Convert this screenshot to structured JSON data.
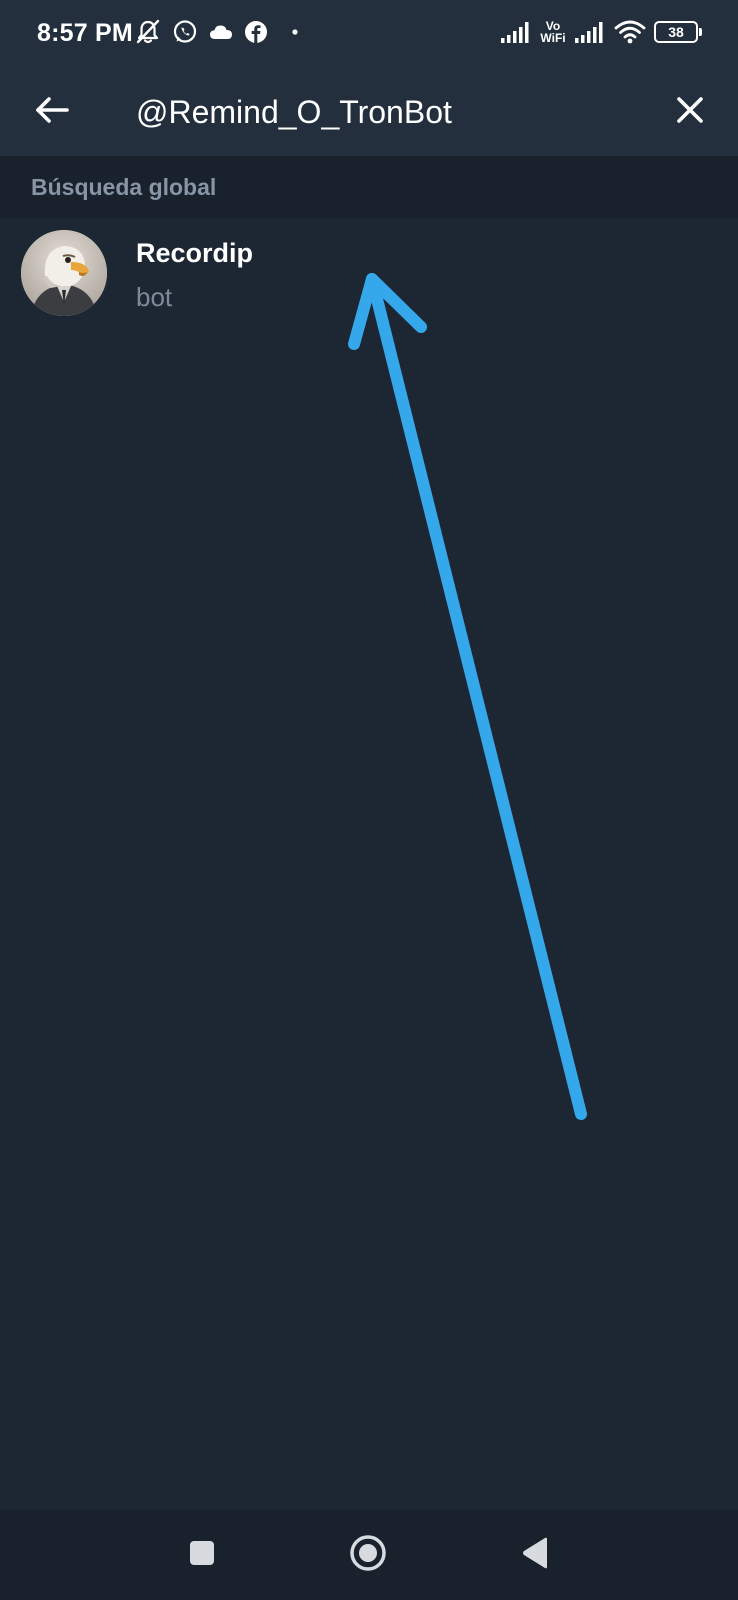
{
  "status_bar": {
    "time": "8:57 PM",
    "vowifi_line1": "Vo",
    "vowifi_line2": "WiFi",
    "battery": "38",
    "icons_left": [
      "muted-bell-icon",
      "whatsapp-icon",
      "cloud-icon",
      "facebook-icon",
      "dot-icon"
    ],
    "icons_right": [
      "signal-icon",
      "vowifi-icon",
      "signal-icon",
      "wifi-icon",
      "battery-icon"
    ]
  },
  "search": {
    "query": "@Remind_O_TronBot",
    "back_icon": "arrow-left-icon",
    "clear_icon": "close-icon"
  },
  "section": {
    "label": "Búsqueda global"
  },
  "results": [
    {
      "title": "Recordip",
      "subtitle": "bot",
      "avatar": "eagle-avatar"
    }
  ],
  "annotation": {
    "type": "arrow",
    "color": "#35a8ec"
  },
  "nav_bar": {
    "items": [
      "recents-square-icon",
      "home-circle-icon",
      "back-triangle-icon"
    ]
  },
  "colors": {
    "background": "#1d2733",
    "header": "#242f3d",
    "section_header": "#18212c",
    "secondary_text": "#8895a4",
    "accent_arrow": "#35a8ec"
  }
}
